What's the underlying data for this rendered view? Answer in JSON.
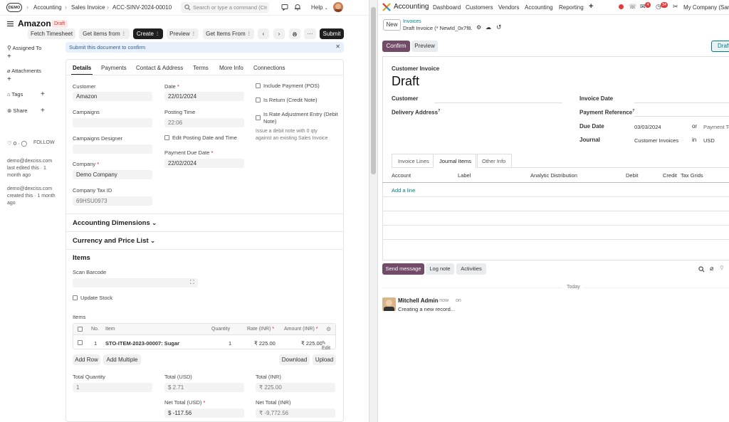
{
  "erp": {
    "logo": "DEMO",
    "breadcrumbs": [
      "Accounting",
      "Sales Invoice",
      "ACC-SINV-2024-00010"
    ],
    "search_placeholder": "Search or type a command (Ctrl + G)",
    "help_label": "Help",
    "doc_title": "Amazon",
    "doc_status": "Draft",
    "actions": {
      "fetch_timesheet": "Fetch Timesheet",
      "get_items_from": "Get items from",
      "create": "Create",
      "preview": "Preview",
      "get_items_from_2": "Get Items From",
      "submit": "Submit"
    },
    "sidebar": {
      "assigned_to": "Assigned To",
      "attachments": "Attachments",
      "tags": "Tags",
      "share": "Share",
      "likes": "0",
      "follow": "FOLLOW",
      "activity": [
        {
          "user": "demo@dexciss.com",
          "text": "last edited this · 1 month ago"
        },
        {
          "user": "demo@dexciss.com",
          "text": "created this · 1 month ago"
        }
      ]
    },
    "alert": "Submit this document to confirm",
    "tabs": [
      "Details",
      "Payments",
      "Contact & Address",
      "Terms",
      "More Info",
      "Connections"
    ],
    "fields": {
      "customer_label": "Customer",
      "customer": "Amazon",
      "campaigns_label": "Campaigns",
      "campaigns_designer_label": "Campaigns Designer",
      "company_label": "Company",
      "company": "Demo Company",
      "company_tax_id_label": "Company Tax ID",
      "company_tax_id": "69HSU0973",
      "date_label": "Date",
      "date": "22/01/2024",
      "posting_time_label": "Posting Time",
      "posting_time": "22:06",
      "edit_posting_label": "Edit Posting Date and Time",
      "payment_due_label": "Payment Due Date",
      "payment_due": "22/02/2024",
      "include_payment": "Include Payment (POS)",
      "is_return": "Is Return (Credit Note)",
      "is_rate_adj": "Is Rate Adjustment Entry (Debit Note)",
      "rate_adj_help": "Issue a debit note with 0 qty against an existing Sales Invoice"
    },
    "sections": {
      "accounting_dimensions": "Accounting Dimensions",
      "currency_price_list": "Currency and Price List",
      "items": "Items"
    },
    "scan_barcode_label": "Scan Barcode",
    "update_stock_label": "Update Stock",
    "items_label": "Items",
    "table": {
      "headers": [
        "No.",
        "Item",
        "Quantity",
        "Rate (INR)",
        "Amount (INR)"
      ],
      "rows": [
        {
          "no": "1",
          "item": "STO-ITEM-2023-00007: Sugar",
          "qty": "1",
          "rate": "₹ 225.00",
          "amount": "₹ 225.00",
          "edit": "Edit"
        }
      ],
      "add_row": "Add Row",
      "add_multiple": "Add Multiple",
      "download": "Download",
      "upload": "Upload"
    },
    "totals": {
      "total_qty_label": "Total Quantity",
      "total_qty": "1",
      "total_usd_label": "Total (USD)",
      "total_usd": "$ 2.71",
      "total_inr_label": "Total (INR)",
      "total_inr": "₹ 225.00",
      "net_total_usd_label": "Net Total (USD)",
      "net_total_usd": "$ -117.56",
      "net_total_inr_label": "Net Total (INR)",
      "net_total_inr": "₹ -9,772.56"
    }
  },
  "odoo": {
    "app_name": "Accounting",
    "nav": [
      "Dashboard",
      "Customers",
      "Vendors",
      "Accounting",
      "Reporting"
    ],
    "badge_messages": "4",
    "badge_activities": "34",
    "company": "My Company (San Francisco)",
    "new_button": "New",
    "breadcrumb_parent": "Invoices",
    "breadcrumb_current": "Draft Invoice (* NewId_0x7f8...",
    "confirm": "Confirm",
    "preview": "Preview",
    "status_draft": "Draft",
    "form_type": "Customer Invoice",
    "form_title": "Draft",
    "customer_label": "Customer",
    "delivery_address_label": "Delivery Address",
    "invoice_date_label": "Invoice Date",
    "payment_reference_label": "Payment Reference",
    "due_date_label": "Due Date",
    "due_date": "03/03/2024",
    "or_label": "or",
    "payment_terms_label": "Payment Terms",
    "journal_label": "Journal",
    "journal": "Customer Invoices",
    "in_label": "in",
    "currency": "USD",
    "tabs": [
      "Invoice Lines",
      "Journal Items",
      "Other Info"
    ],
    "table_headers": [
      "Account",
      "Label",
      "Analytic Distribution",
      "Debit",
      "Credit",
      "Tax Grids"
    ],
    "add_line": "Add a line",
    "chatter": {
      "send_message": "Send message",
      "log_note": "Log note",
      "activities": "Activities",
      "today": "Today",
      "author": "Mitchell Admin",
      "time": "now",
      "on": "on",
      "message": "Creating a new record..."
    }
  },
  "colors": {
    "odoo_primary": "#714b67",
    "erp_dark": "#1f1f1f",
    "alert_bg": "#e8f1fb",
    "odoo_link": "#017e84",
    "badge_red": "#e4393c"
  }
}
